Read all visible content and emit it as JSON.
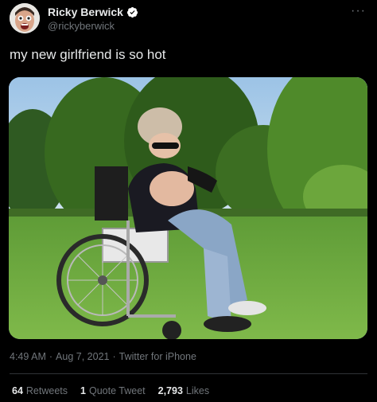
{
  "tweet": {
    "author_name": "Ricky Berwick",
    "handle": "@rickyberwick",
    "text": "my new girlfriend is so hot",
    "more_icon": "···",
    "time": "4:49 AM",
    "date": "Aug 7, 2021",
    "source": "Twitter for iPhone",
    "separator": "·"
  },
  "stats": {
    "retweets_count": "64",
    "retweets_label": "Retweets",
    "quotes_count": "1",
    "quotes_label": "Quote Tweet",
    "likes_count": "2,793",
    "likes_label": "Likes"
  },
  "colors": {
    "background": "#000000",
    "text_primary": "#e7e9ea",
    "text_secondary": "#71767b",
    "verified": "#ffffff"
  },
  "icons": {
    "verified": "verified-badge-icon",
    "more": "more-icon"
  }
}
